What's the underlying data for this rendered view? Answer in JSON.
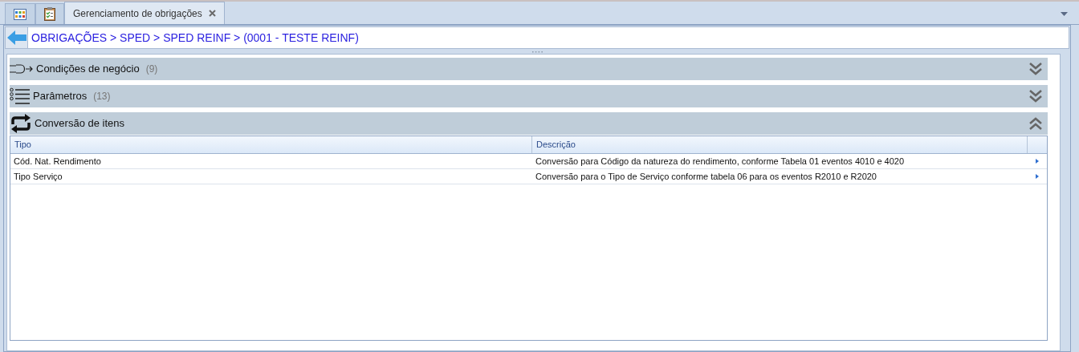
{
  "tabs": [
    {
      "selected": false
    },
    {
      "selected": false
    },
    {
      "label": "Gerenciamento de obrigações",
      "selected": true
    }
  ],
  "breadcrumb": "OBRIGAÇÕES > SPED > SPED REINF > (0001 - TESTE REINF)",
  "sections": [
    {
      "title": "Condições de negócio",
      "count": "(9)",
      "expanded": false
    },
    {
      "title": "Parâmetros",
      "count": "(13)",
      "expanded": false
    },
    {
      "title": "Conversão de itens",
      "expanded": true
    }
  ],
  "table": {
    "columns": [
      "Tipo",
      "Descrição"
    ],
    "rows": [
      [
        "Cód. Nat. Rendimento",
        "Conversão para Código da natureza do rendimento, conforme Tabela 01 eventos 4010 e 4020"
      ],
      [
        "Tipo Serviço",
        "Conversão para o Tipo de Serviço conforme tabela 06 para os eventos R2010 e R2020"
      ]
    ]
  }
}
